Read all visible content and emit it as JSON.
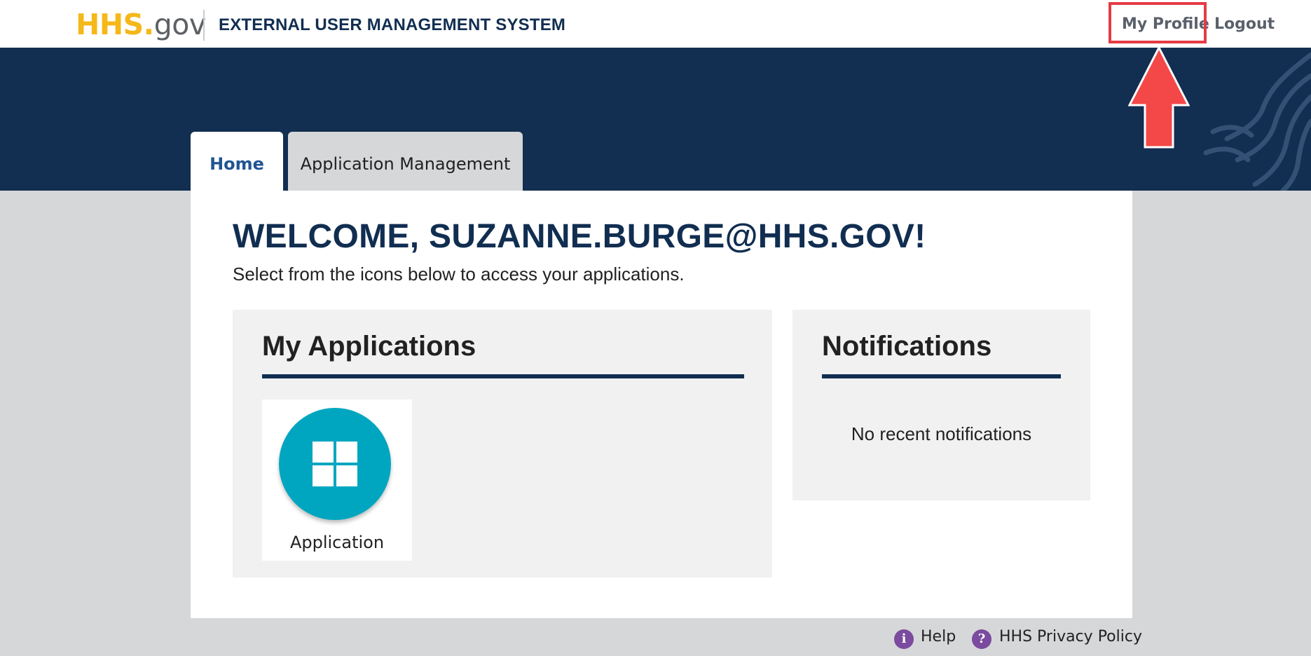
{
  "header": {
    "logo": {
      "hhs": "HHS",
      "dot": ".",
      "gov": "gov"
    },
    "system_title": "EXTERNAL USER MANAGEMENT SYSTEM",
    "nav": {
      "my_profile": "My Profile",
      "logout": "Logout"
    }
  },
  "tabs": [
    {
      "label": "Home",
      "active": true
    },
    {
      "label": "Application Management",
      "active": false
    }
  ],
  "main": {
    "welcome": "WELCOME, SUZANNE.BURGE@HHS.GOV!",
    "subtitle": "Select from the icons below to access your applications."
  },
  "my_applications": {
    "heading": "My Applications",
    "items": [
      {
        "label": "Application",
        "icon": "grid-icon"
      }
    ]
  },
  "notifications": {
    "heading": "Notifications",
    "empty_message": "No recent notifications"
  },
  "footer": {
    "help": {
      "label": "Help",
      "icon": "info-icon",
      "glyph": "i"
    },
    "privacy": {
      "label": "HHS Privacy Policy",
      "icon": "question-icon",
      "glyph": "?"
    }
  },
  "colors": {
    "navy": "#112e51",
    "banner": "#122e51",
    "gold": "#f5b819",
    "teal": "#00a6c0",
    "annotation_red": "#e53b45",
    "footer_icon": "#7a4b9e"
  }
}
